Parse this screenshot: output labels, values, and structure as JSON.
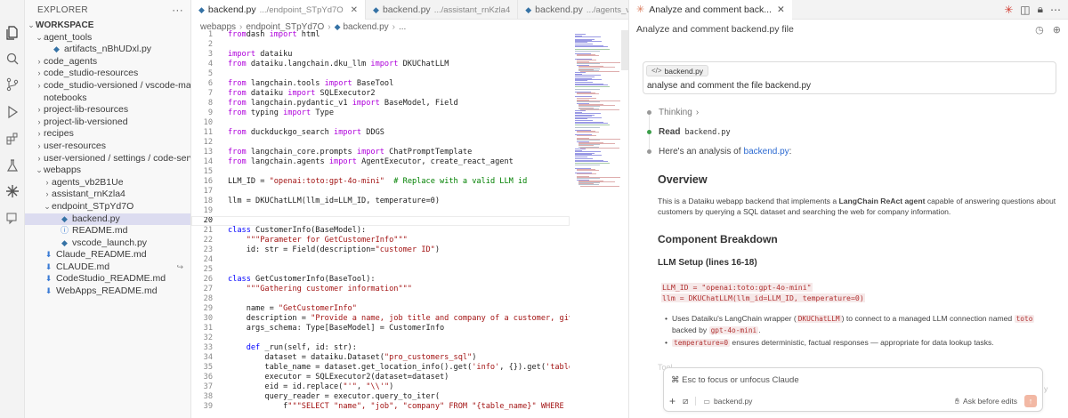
{
  "explorer": {
    "title": "EXPLORER",
    "more": "···",
    "workspace": "WORKSPACE",
    "items": [
      {
        "label": "agent_tools",
        "depth": 1,
        "type": "folder-open"
      },
      {
        "label": "artifacts_nBhUDxl.py",
        "depth": 2,
        "type": "py"
      },
      {
        "label": "code_agents",
        "depth": 1,
        "type": "folder"
      },
      {
        "label": "code_studio-resources",
        "depth": 1,
        "type": "folder"
      },
      {
        "label": "code_studio-versioned / vscode-machine-...",
        "depth": 1,
        "type": "folder"
      },
      {
        "label": "notebooks",
        "depth": 1,
        "type": "none"
      },
      {
        "label": "project-lib-resources",
        "depth": 1,
        "type": "folder"
      },
      {
        "label": "project-lib-versioned",
        "depth": 1,
        "type": "folder"
      },
      {
        "label": "recipes",
        "depth": 1,
        "type": "folder"
      },
      {
        "label": "user-resources",
        "depth": 1,
        "type": "folder"
      },
      {
        "label": "user-versioned / settings / code-server",
        "depth": 1,
        "type": "folder"
      },
      {
        "label": "webapps",
        "depth": 1,
        "type": "folder-open"
      },
      {
        "label": "agents_vb2B1Ue",
        "depth": 2,
        "type": "folder"
      },
      {
        "label": "assistant_rnKzla4",
        "depth": 2,
        "type": "folder"
      },
      {
        "label": "endpoint_STpYd7O",
        "depth": 2,
        "type": "folder-open"
      },
      {
        "label": "backend.py",
        "depth": 3,
        "type": "py",
        "selected": true
      },
      {
        "label": "README.md",
        "depth": 3,
        "type": "info"
      },
      {
        "label": "vscode_launch.py",
        "depth": 3,
        "type": "py"
      },
      {
        "label": "Claude_README.md",
        "depth": 1,
        "type": "md"
      },
      {
        "label": "CLAUDE.md",
        "depth": 1,
        "type": "md",
        "extra": "↪"
      },
      {
        "label": "CodeStudio_README.md",
        "depth": 1,
        "type": "md"
      },
      {
        "label": "WebApps_README.md",
        "depth": 1,
        "type": "md"
      }
    ]
  },
  "editor": {
    "tabs": [
      {
        "name": "backend.py",
        "path": ".../endpoint_STpYd7O",
        "active": true
      },
      {
        "name": "backend.py",
        "path": ".../assistant_rnKzla4",
        "active": false
      },
      {
        "name": "backend.py",
        "path": ".../agents_vb2B1Ue",
        "active": false
      }
    ],
    "tab_more": "···",
    "breadcrumb": [
      "webapps",
      "endpoint_STpYd7O",
      "backend.py",
      "..."
    ],
    "current_line": 20,
    "lines": [
      {
        "n": "1",
        "tokens": [
          [
            "kw2",
            "from"
          ],
          [
            "",
            "dash "
          ],
          [
            "kw2",
            "import"
          ],
          [
            "",
            " html"
          ]
        ]
      },
      {
        "n": "2",
        "tokens": []
      },
      {
        "n": "3",
        "tokens": [
          [
            "kw2",
            "import"
          ],
          [
            "",
            " dataiku"
          ]
        ]
      },
      {
        "n": "4",
        "tokens": [
          [
            "kw2",
            "from"
          ],
          [
            "",
            " dataiku.langchain.dku_llm "
          ],
          [
            "kw2",
            "import"
          ],
          [
            "",
            " DKUChatLLM"
          ]
        ]
      },
      {
        "n": "5",
        "tokens": []
      },
      {
        "n": "6",
        "tokens": [
          [
            "kw2",
            "from"
          ],
          [
            "",
            " langchain.tools "
          ],
          [
            "kw2",
            "import"
          ],
          [
            "",
            " BaseTool"
          ]
        ]
      },
      {
        "n": "7",
        "tokens": [
          [
            "kw2",
            "from"
          ],
          [
            "",
            " dataiku "
          ],
          [
            "kw2",
            "import"
          ],
          [
            "",
            " SQLExecutor2"
          ]
        ]
      },
      {
        "n": "8",
        "tokens": [
          [
            "kw2",
            "from"
          ],
          [
            "",
            " langchain.pydantic_v1 "
          ],
          [
            "kw2",
            "import"
          ],
          [
            "",
            " BaseModel, Field"
          ]
        ]
      },
      {
        "n": "9",
        "tokens": [
          [
            "kw2",
            "from"
          ],
          [
            "",
            " typing "
          ],
          [
            "kw2",
            "import"
          ],
          [
            "",
            " Type"
          ]
        ]
      },
      {
        "n": "10",
        "tokens": []
      },
      {
        "n": "11",
        "tokens": [
          [
            "kw2",
            "from"
          ],
          [
            "",
            " duckduckgo_search "
          ],
          [
            "kw2",
            "import"
          ],
          [
            "",
            " DDGS"
          ]
        ]
      },
      {
        "n": "12",
        "tokens": []
      },
      {
        "n": "13",
        "tokens": [
          [
            "kw2",
            "from"
          ],
          [
            "",
            " langchain_core.prompts "
          ],
          [
            "kw2",
            "import"
          ],
          [
            "",
            " ChatPromptTemplate"
          ]
        ]
      },
      {
        "n": "14",
        "tokens": [
          [
            "kw2",
            "from"
          ],
          [
            "",
            " langchain.agents "
          ],
          [
            "kw2",
            "import"
          ],
          [
            "",
            " AgentExecutor, create_react_agent"
          ]
        ]
      },
      {
        "n": "15",
        "tokens": []
      },
      {
        "n": "16",
        "tokens": [
          [
            "",
            "LLM_ID = "
          ],
          [
            "str",
            "\"openai:toto:gpt-4o-mini\""
          ],
          [
            "",
            "  "
          ],
          [
            "cmt",
            "# Replace with a valid LLM id"
          ]
        ]
      },
      {
        "n": "17",
        "tokens": []
      },
      {
        "n": "18",
        "tokens": [
          [
            "",
            "llm = DKUChatLLM(llm_id=LLM_ID, temperature=0)"
          ]
        ]
      },
      {
        "n": "19",
        "tokens": []
      },
      {
        "n": "20",
        "tokens": []
      },
      {
        "n": "21",
        "tokens": [
          [
            "kw",
            "class"
          ],
          [
            "",
            " CustomerInfo(BaseModel):"
          ]
        ]
      },
      {
        "n": "22",
        "tokens": [
          [
            "",
            "    "
          ],
          [
            "str",
            "\"\"\"Parameter for GetCustomerInfo\"\"\""
          ]
        ]
      },
      {
        "n": "23",
        "tokens": [
          [
            "",
            "    id: str = Field(description="
          ],
          [
            "str",
            "\"customer ID\""
          ],
          [
            "",
            ")"
          ]
        ]
      },
      {
        "n": "24",
        "tokens": []
      },
      {
        "n": "25",
        "tokens": []
      },
      {
        "n": "26",
        "tokens": [
          [
            "kw",
            "class"
          ],
          [
            "",
            " GetCustomerInfo(BaseTool):"
          ]
        ]
      },
      {
        "n": "27",
        "tokens": [
          [
            "",
            "    "
          ],
          [
            "str",
            "\"\"\"Gathering customer information\"\"\""
          ]
        ]
      },
      {
        "n": "28",
        "tokens": []
      },
      {
        "n": "29",
        "tokens": [
          [
            "",
            "    name = "
          ],
          [
            "str",
            "\"GetCustomerInfo\""
          ]
        ]
      },
      {
        "n": "30",
        "tokens": [
          [
            "",
            "    description = "
          ],
          [
            "str",
            "\"Provide a name, job title and company of a customer, given the cust"
          ]
        ]
      },
      {
        "n": "31",
        "tokens": [
          [
            "",
            "    args_schema: Type[BaseModel] = CustomerInfo"
          ]
        ]
      },
      {
        "n": "32",
        "tokens": []
      },
      {
        "n": "33",
        "tokens": [
          [
            "",
            "    "
          ],
          [
            "kw",
            "def"
          ],
          [
            "",
            " _run(self, id: str):"
          ]
        ]
      },
      {
        "n": "34",
        "tokens": [
          [
            "",
            "        dataset = dataiku.Dataset("
          ],
          [
            "str",
            "\"pro_customers_sql\""
          ],
          [
            "",
            ")"
          ]
        ]
      },
      {
        "n": "35",
        "tokens": [
          [
            "",
            "        table_name = dataset.get_location_info().get("
          ],
          [
            "str",
            "'info'"
          ],
          [
            "",
            ", {}).get("
          ],
          [
            "str",
            "'table'"
          ],
          [
            "",
            ")"
          ]
        ]
      },
      {
        "n": "36",
        "tokens": [
          [
            "",
            "        executor = SQLExecutor2(dataset=dataset)"
          ]
        ]
      },
      {
        "n": "37",
        "tokens": [
          [
            "",
            "        eid = id.replace("
          ],
          [
            "str",
            "\"'\""
          ],
          [
            "",
            ", "
          ],
          [
            "str",
            "\"\\\\'\""
          ],
          [
            "",
            ")"
          ]
        ]
      },
      {
        "n": "38",
        "tokens": [
          [
            "",
            "        query_reader = executor.query_to_iter("
          ]
        ]
      },
      {
        "n": "39",
        "tokens": [
          [
            "",
            "            f"
          ],
          [
            "str",
            "\"\"\"SELECT \"name\", \"job\", \"company\" FROM \"{table_name}\" WHERE \"id\" = '{eid"
          ]
        ]
      }
    ]
  },
  "panel": {
    "tab_title": "Analyze and comment back...",
    "subtitle": "Analyze and comment backend.py file",
    "user_chip": "backend.py",
    "user_message": "analyse and comment the file backend.py",
    "thinking": "Thinking",
    "read_label": "Read",
    "read_file": "backend.py",
    "intro_text": "Here's an analysis of",
    "intro_link": "backend.py",
    "intro_end": ":",
    "overview_heading": "Overview",
    "overview_p1": "This is a Dataiku webapp backend that implements a",
    "overview_bold": "LangChain ReAct agent",
    "overview_p2": "capable of answering questions about customers by querying a SQL dataset and searching the web for company information.",
    "breakdown_heading": "Component Breakdown",
    "llm_heading": "LLM Setup (lines 16-18)",
    "code_lines": [
      "LLM_ID = \"openai:toto:gpt-4o-mini\"",
      "llm = DKUChatLLM(llm_id=LLM_ID, temperature=0)"
    ],
    "bullet1_a": "Uses Dataiku's LangChain wrapper (",
    "bullet1_code1": "DKUChatLLM",
    "bullet1_b": ") to connect to a managed LLM connection named",
    "bullet1_code2": "toto",
    "bullet1_c": "backed by",
    "bullet1_code3": "gpt-4o-mini",
    "bullet1_d": ".",
    "bullet2_code": "temperature=0",
    "bullet2_text": "ensures deterministic, factual responses — appropriate for data lookup tasks.",
    "faded_text": "Tool",
    "faded_right": "y",
    "composer_placeholder": "⌘ Esc to focus or unfocus Claude",
    "composer_file": "backend.py",
    "composer_mode": "Ask before edits"
  }
}
